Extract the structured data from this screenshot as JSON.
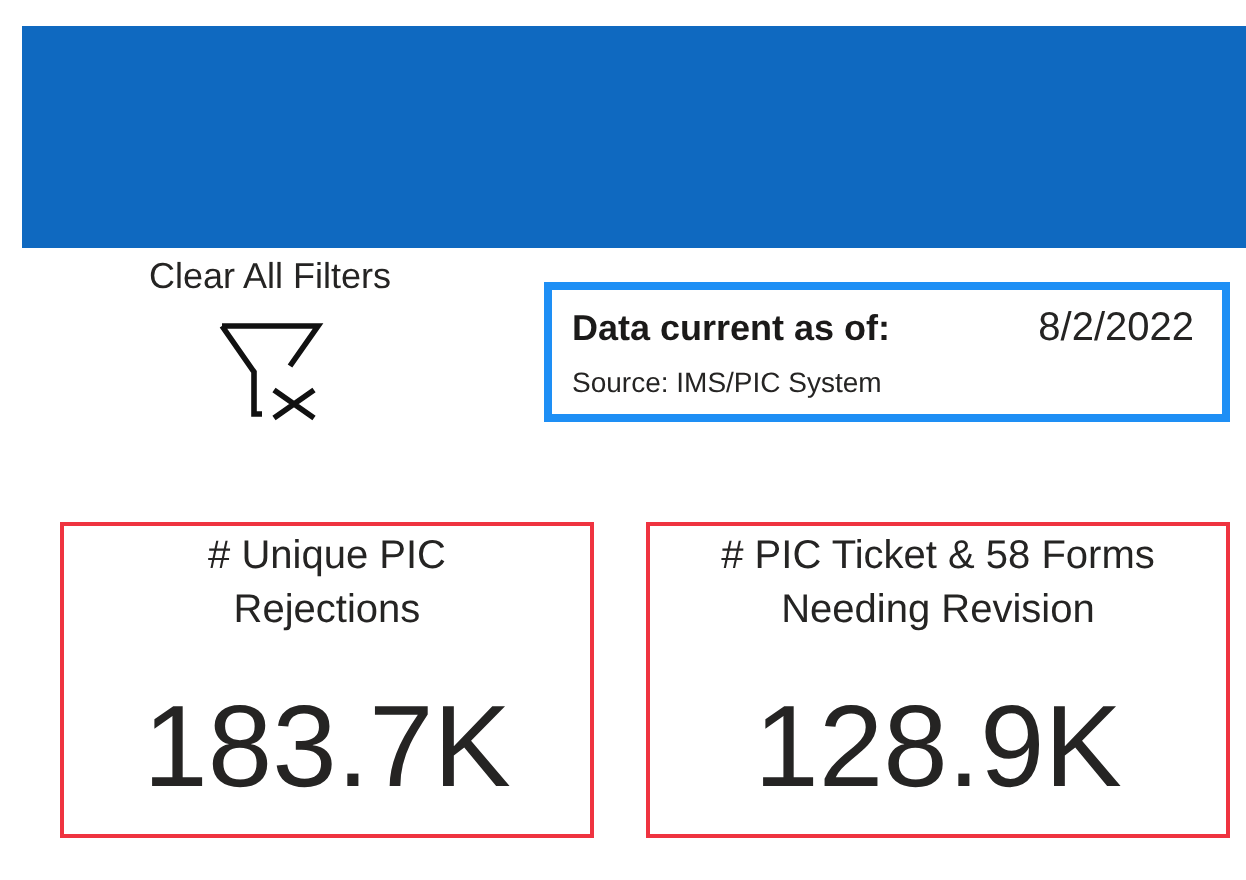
{
  "banner": {
    "kind": "blank"
  },
  "clear_filters": {
    "label": "Clear All Filters"
  },
  "data_info": {
    "label": "Data current as of:",
    "date": "8/2/2022",
    "source": "Source: IMS/PIC System"
  },
  "cards": [
    {
      "title": "# Unique PIC Rejections",
      "value": "183.7K"
    },
    {
      "title": "# PIC Ticket & 58 Forms Needing Revision",
      "value": "128.9K"
    }
  ]
}
